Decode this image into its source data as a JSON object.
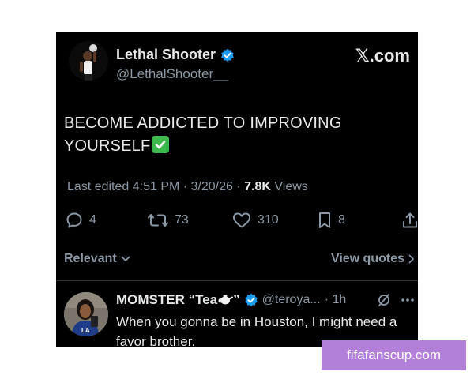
{
  "post": {
    "author_name": "Lethal Shooter",
    "author_handle": "@LethalShooter__",
    "verified_icon": "verified-badge-icon",
    "source": "𝕏.com",
    "text": "BECOME ADDICTED TO IMPROVING YOURSELF",
    "trailing_emoji": "check-mark-button-icon",
    "edited_label": "Last edited 4:51 PM · 3/20/26 · ",
    "views_count": "7.8K",
    "views_label": " Views"
  },
  "actions": {
    "replies": "4",
    "reposts": "73",
    "likes": "310",
    "bookmarks": "8"
  },
  "sort": {
    "label": "Relevant",
    "view_quotes": "View quotes"
  },
  "reply": {
    "name": "MOMSTER “Tea",
    "name_suffix": "”",
    "handle": "@teroya...",
    "time": "· 1h",
    "text": "When you gonna be in Houston, I might need a favor brother."
  },
  "watermark": "fifafanscup.com",
  "colors": {
    "background": "#000000",
    "text": "#e7e9ea",
    "muted": "#8b98a5",
    "verified": "#1d9bf0",
    "watermark_bg": "#b27fd9"
  }
}
